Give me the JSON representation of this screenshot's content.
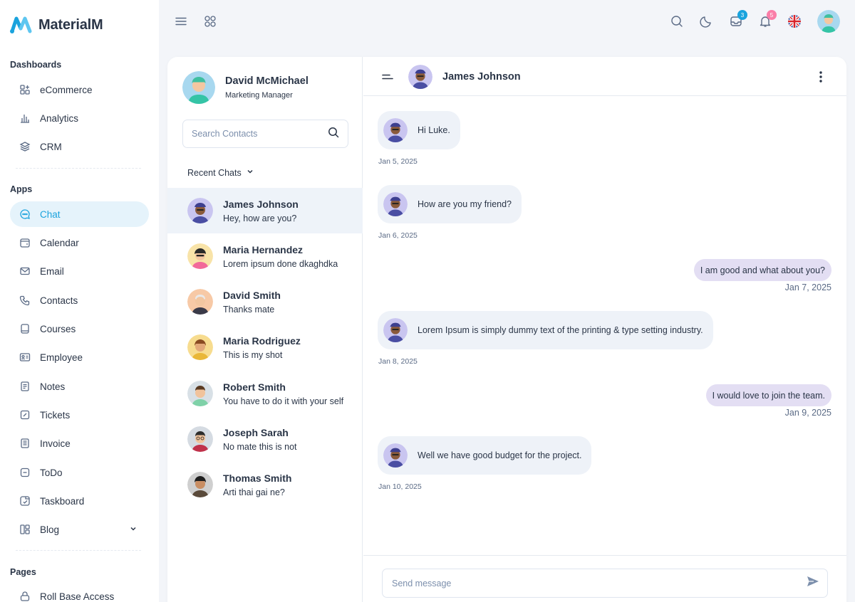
{
  "brand": {
    "name": "MaterialM"
  },
  "sidebar": {
    "sections": [
      "Dashboards",
      "Apps",
      "Pages"
    ],
    "dashboards": [
      {
        "label": "eCommerce",
        "icon": "grid-plus-icon"
      },
      {
        "label": "Analytics",
        "icon": "bar-chart-icon"
      },
      {
        "label": "CRM",
        "icon": "layers-icon"
      }
    ],
    "apps": [
      {
        "label": "Chat",
        "icon": "chat-icon",
        "active": true
      },
      {
        "label": "Calendar",
        "icon": "calendar-icon"
      },
      {
        "label": "Email",
        "icon": "mail-icon"
      },
      {
        "label": "Contacts",
        "icon": "phone-icon"
      },
      {
        "label": "Courses",
        "icon": "book-icon"
      },
      {
        "label": "Employee",
        "icon": "id-card-icon"
      },
      {
        "label": "Notes",
        "icon": "notes-icon"
      },
      {
        "label": "Tickets",
        "icon": "ticket-icon"
      },
      {
        "label": "Invoice",
        "icon": "invoice-icon"
      },
      {
        "label": "ToDo",
        "icon": "todo-icon"
      },
      {
        "label": "Taskboard",
        "icon": "taskboard-icon"
      },
      {
        "label": "Blog",
        "icon": "blog-icon",
        "expandable": true
      }
    ],
    "pages": [
      {
        "label": "Roll Base Access",
        "icon": "lock-icon"
      }
    ]
  },
  "topbar": {
    "mail_badge": "3",
    "notification_badge": "5",
    "accent": "#1aa3dd",
    "badge_blue": "#1aa3dd",
    "badge_pink": "#fa7ea8"
  },
  "profile": {
    "name": "David McMichael",
    "role": "Marketing Manager"
  },
  "search": {
    "placeholder": "Search Contacts"
  },
  "recent_label": "Recent Chats",
  "contacts": [
    {
      "name": "James Johnson",
      "message": "Hey, how are you?",
      "active": true
    },
    {
      "name": "Maria Hernandez",
      "message": "Lorem ipsum done dkaghdka"
    },
    {
      "name": "David Smith",
      "message": "Thanks mate"
    },
    {
      "name": "Maria Rodriguez",
      "message": "This is my shot"
    },
    {
      "name": "Robert Smith",
      "message": "You have to do it with your self"
    },
    {
      "name": "Joseph Sarah",
      "message": "No mate this is not"
    },
    {
      "name": "Thomas Smith",
      "message": "Arti thai gai ne?"
    }
  ],
  "chat": {
    "contact_name": "James Johnson",
    "messages": [
      {
        "direction": "in",
        "text": "Hi Luke.",
        "time": "Jan 5, 2025"
      },
      {
        "direction": "in",
        "text": "How are you my friend?",
        "time": "Jan 6, 2025"
      },
      {
        "direction": "out",
        "text": "I am good and what about you?",
        "time": "Jan 7, 2025"
      },
      {
        "direction": "in",
        "text": "Lorem Ipsum is simply dummy text of the printing & type setting industry.",
        "time": "Jan 8, 2025"
      },
      {
        "direction": "out",
        "text": "I would love to join the team.",
        "time": "Jan 9, 2025"
      },
      {
        "direction": "in",
        "text": "Well we have good budget for the project.",
        "time": "Jan 10, 2025"
      }
    ],
    "compose_placeholder": "Send message"
  }
}
